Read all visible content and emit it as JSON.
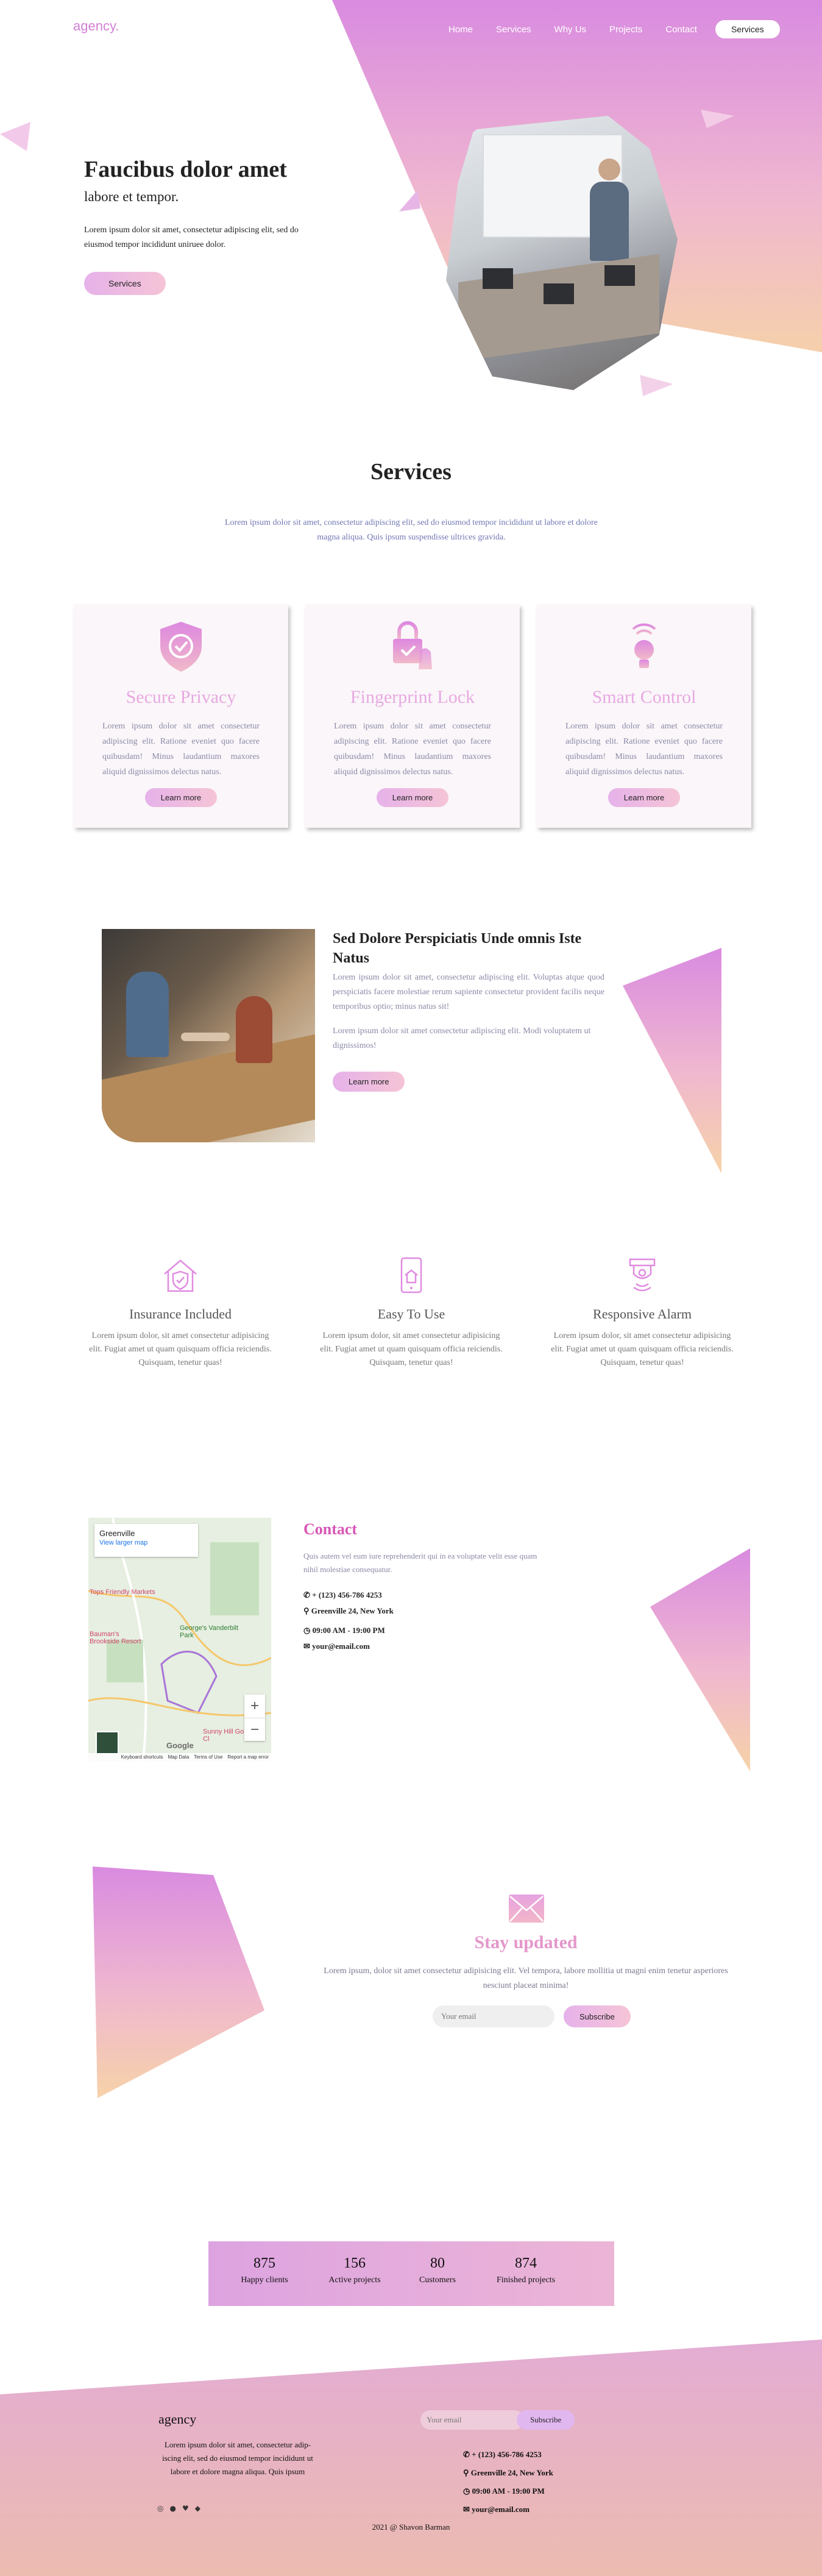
{
  "colors": {
    "accent": "#e08be0",
    "brand": "#d98be0",
    "peach": "#f6d2a8",
    "text_muted": "#8a8aa8"
  },
  "nav": {
    "logo": "agency.",
    "items": [
      "Home",
      "Services",
      "Why Us",
      "Projects",
      "Contact"
    ],
    "cta": "Services"
  },
  "hero": {
    "title": "Faucibus dolor amet",
    "subtitle": "labore et tempor.",
    "body": "Lorem ipsum dolor sit amet, consectetur adipiscing elit, sed do eiusmod tempor incididunt uniruee dolor.",
    "button": "Services"
  },
  "services": {
    "title": "Services",
    "intro": "Lorem ipsum dolor sit amet, consectetur adipiscing elit, sed do eiusmod tempor incididunt ut labore et dolore magna aliqua. Quis ipsum suspendisse ultrices gravida.",
    "cards": [
      {
        "icon": "shield-check-icon",
        "title": "Secure Privacy",
        "text": "Lorem ipsum dolor sit amet consectetur adipiscing elit. Ratione eveniet quo facere quibusdam! Minus laudantium maxores aliquid dignissimos delectus natus.",
        "button": "Learn more"
      },
      {
        "icon": "fingerprint-lock-icon",
        "title": "Fingerprint Lock",
        "text": "Lorem ipsum dolor sit amet consectetur adipiscing elit. Ratione eveniet quo facere quibusdam! Minus laudantium maxores aliquid dignissimos delectus natus.",
        "button": "Learn more"
      },
      {
        "icon": "smart-bulb-icon",
        "title": "Smart Control",
        "text": "Lorem ipsum dolor sit amet consectetur adipiscing elit. Ratione eveniet quo facere quibusdam! Minus laudantium maxores aliquid dignissimos delectus natus.",
        "button": "Learn more"
      }
    ]
  },
  "about": {
    "title": "Sed Dolore Perspiciatis Unde omnis Iste Natus",
    "p1": "Lorem ipsum dolor sit amet, consectetur adipiscing elit. Voluptas atque quod perspiciatis facere molestiae rerum sapiente consectetur provident facilis neque temporibus optio; minus natus sit!",
    "p2": "Lorem ipsum dolor sit amet consectetur adipiscing elit. Modi voluptatem ut dignissimos!",
    "button": "Learn more"
  },
  "features": [
    {
      "icon": "house-shield-icon",
      "title": "Insurance Included",
      "text": "Lorem ipsum dolor, sit amet consectetur adipisicing elit. Fugiat amet ut quam quisquam officia reiciendis. Quisquam, tenetur quas!"
    },
    {
      "icon": "phone-house-icon",
      "title": "Easy To Use",
      "text": "Lorem ipsum dolor, sit amet consectetur adipisicing elit. Fugiat amet ut quam quisquam officia reiciendis. Quisquam, tenetur quas!"
    },
    {
      "icon": "alarm-sensor-icon",
      "title": "Responsive Alarm",
      "text": "Lorem ipsum dolor, sit amet consectetur adipisicing elit. Fugiat amet ut quam quisquam officia reiciendis. Quisquam, tenetur quas!"
    }
  ],
  "contact": {
    "title": "Contact",
    "body": "Quis autem vel eum iure reprehenderit qui in ea voluptate velit esse quam nihil molestiae consequatur.",
    "phone": "+ (123) 456-786 4253",
    "address": "Greenville 24, New York",
    "hours": "09:00 AM - 19:00 PM",
    "email": "your@email.com"
  },
  "map": {
    "place": "Greenville",
    "link": "View larger map",
    "labels": [
      "Tops Friendly Markets",
      "Bauman's Brookside Resort",
      "George's Vanderbilt Park",
      "Sunny Hill Golf Cl"
    ],
    "footer": [
      "Keyboard shortcuts",
      "Map Data",
      "Terms of Use",
      "Report a map error"
    ],
    "google": "Google",
    "zoom_in": "+",
    "zoom_out": "−"
  },
  "newsletter": {
    "title": "Stay updated",
    "body": "Lorem ipsum, dolor sit amet consectetur adipisicing elit. Vel tempora, labore mollitia ut magni enim tenetur asperiores nesciunt placeat minima!",
    "placeholder": "Your email",
    "button": "Subscribe"
  },
  "stats": [
    {
      "value": "875",
      "label": "Happy clients"
    },
    {
      "value": "156",
      "label": "Active projects"
    },
    {
      "value": "80",
      "label": "Customers"
    },
    {
      "value": "874",
      "label": "Finished projects"
    }
  ],
  "footer": {
    "logo": "agency",
    "body": "Lorem ipsum dolor sit amet, consectetur adip-iscing elit, sed do eiusmod tempor incididunt ut labore et dolore magna aliqua. Quis ipsum",
    "placeholder": "Your email",
    "button": "Subscribe",
    "phone": "+ (123) 456-786 4253",
    "address": "Greenville 24, New York",
    "hours": "09:00 AM - 19:00 PM",
    "email": "your@email.com",
    "copyright": "2021 @ Shavon Barman",
    "social": [
      "instagram-icon",
      "facebook-icon",
      "twitter-icon",
      "chat-icon"
    ]
  }
}
